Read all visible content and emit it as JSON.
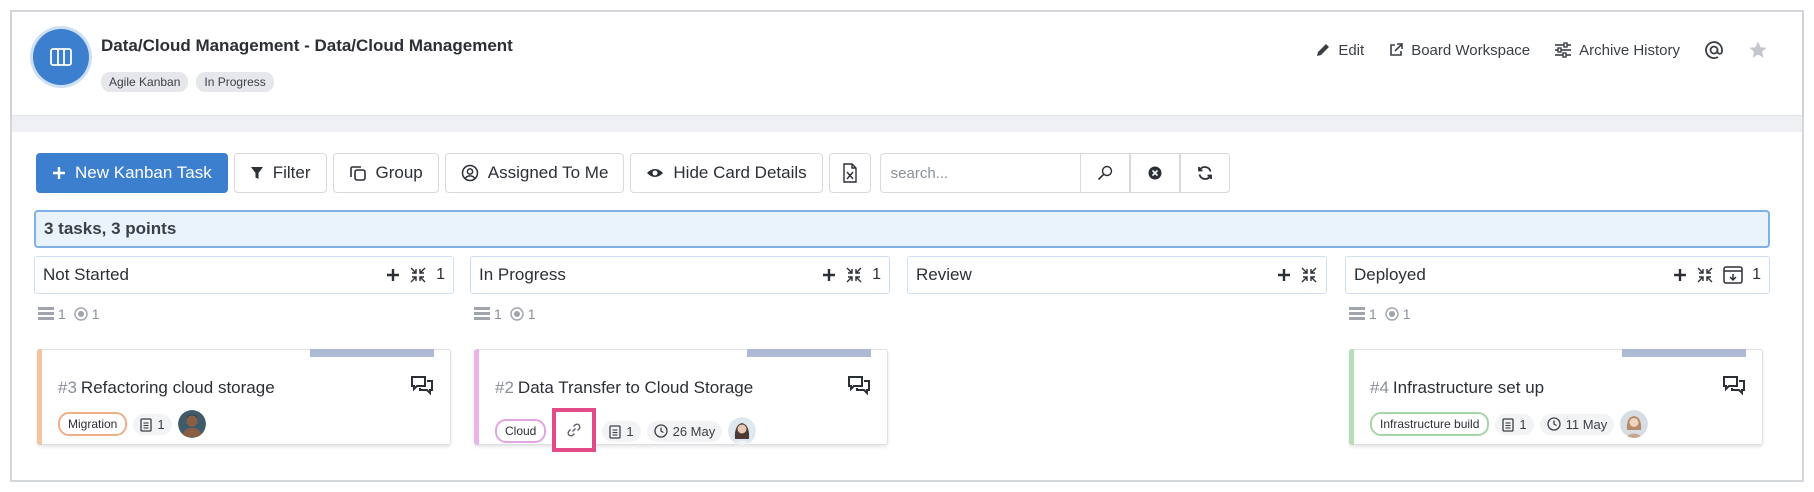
{
  "header": {
    "title": "Data/Cloud Management - Data/Cloud Management",
    "tags": [
      "Agile Kanban",
      "In Progress"
    ],
    "actions": {
      "edit": "Edit",
      "board_workspace": "Board Workspace",
      "archive_history": "Archive History"
    }
  },
  "toolbar": {
    "new_task": "New Kanban Task",
    "filter": "Filter",
    "group": "Group",
    "assigned_to_me": "Assigned To Me",
    "hide_card_details": "Hide Card Details",
    "search_placeholder": "search..."
  },
  "summary": "3 tasks, 3 points",
  "columns": [
    {
      "title": "Not Started",
      "count": "1",
      "meta_tasks": "1",
      "meta_points": "1"
    },
    {
      "title": "In Progress",
      "count": "1",
      "meta_tasks": "1",
      "meta_points": "1"
    },
    {
      "title": "Review"
    },
    {
      "title": "Deployed",
      "count": "1",
      "meta_tasks": "1",
      "meta_points": "1"
    }
  ],
  "cards": [
    {
      "number": "#3",
      "title": "Refactoring cloud storage",
      "label": "Migration",
      "label_color": "#f0b087",
      "accent": "#f3c4a0",
      "points": "1"
    },
    {
      "number": "#2",
      "title": "Data Transfer to Cloud Storage",
      "label": "Cloud",
      "label_color": "#e2a6e4",
      "accent": "#e9b4ea",
      "points": "1",
      "due": "26 May"
    },
    {
      "number": "#4",
      "title": "Infrastructure set up",
      "label": "Infrastructure build",
      "label_color": "#a6d6a8",
      "accent": "#b6dcb8",
      "points": "1",
      "due": "11 May"
    }
  ],
  "colors": {
    "accent": "#3d7fcf",
    "highlight": "#e24a88"
  }
}
